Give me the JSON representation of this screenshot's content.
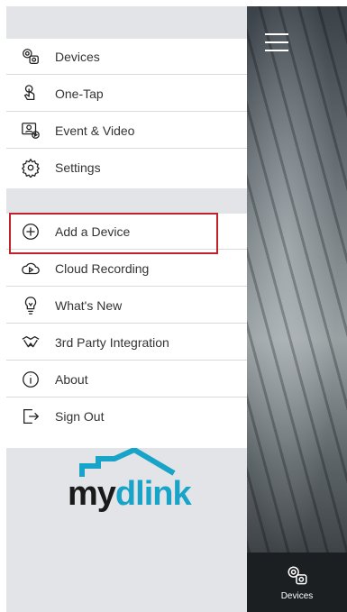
{
  "menu": {
    "group1": [
      {
        "label": "Devices",
        "icon": "devices-icon"
      },
      {
        "label": "One-Tap",
        "icon": "hand-tap-icon"
      },
      {
        "label": "Event & Video",
        "icon": "event-video-icon"
      },
      {
        "label": "Settings",
        "icon": "gear-icon"
      }
    ],
    "group2": [
      {
        "label": "Add a Device",
        "icon": "plus-circle-icon"
      },
      {
        "label": "Cloud Recording",
        "icon": "cloud-icon"
      },
      {
        "label": "What's New",
        "icon": "lightbulb-icon"
      },
      {
        "label": "3rd Party Integration",
        "icon": "handshake-icon"
      },
      {
        "label": "About",
        "icon": "info-icon"
      },
      {
        "label": "Sign Out",
        "icon": "sign-out-icon"
      }
    ]
  },
  "logo": {
    "part1": "my",
    "part2": "dlink"
  },
  "bottom_tab": {
    "label": "Devices",
    "icon": "devices-icon"
  },
  "colors": {
    "accent": "#18a3c8",
    "highlight": "#c0222a"
  }
}
